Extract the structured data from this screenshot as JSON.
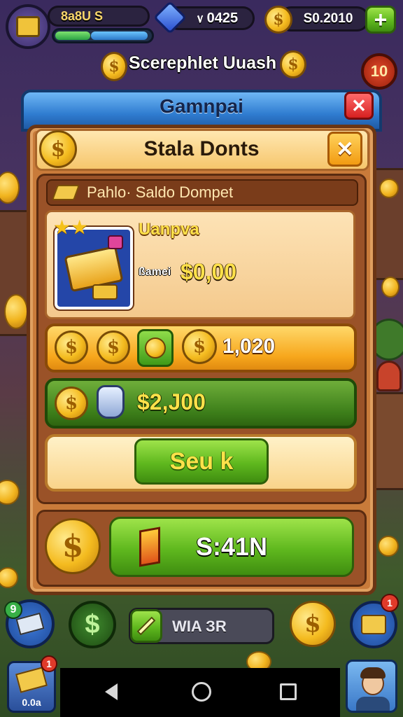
{
  "hud": {
    "level_label": "8a8U S",
    "gems_value": "᥎ 0425",
    "coins_value": "S0.2010",
    "plus_label": "+",
    "banner_text": "Scerephlet Uuash",
    "timer_badge": "10"
  },
  "window": {
    "title": "Gamnpai",
    "close_label": "✕"
  },
  "panel": {
    "title": "Stala Donts",
    "close_label": "✕",
    "section_label": "Pahlo· Saldo Dompet",
    "item": {
      "name": "Uanpva",
      "price_prefix": "ßamei",
      "price_value": "$0,00"
    },
    "coin_row_value": "1,020",
    "money_row_value": "$2,J00",
    "action_button_label": "Seu k",
    "bottom_button_label": "S:41N"
  },
  "bottom_bar": {
    "progress_label": "WIA ЗR",
    "left_badge": "9",
    "card_badge": "1",
    "card_label": "0.0a",
    "right_badge": "1"
  },
  "colors": {
    "accent_green": "#5fb81e",
    "gold": "#f4bb1f",
    "window_blue": "#2f7cd0",
    "panel_cream": "#f9dca8",
    "close_red": "#d62020"
  },
  "icons": [
    "shop-icon",
    "gem-icon",
    "coin-icon",
    "money-bag-icon",
    "wallet-icon",
    "back-icon",
    "home-icon",
    "recents-icon",
    "avatar"
  ]
}
